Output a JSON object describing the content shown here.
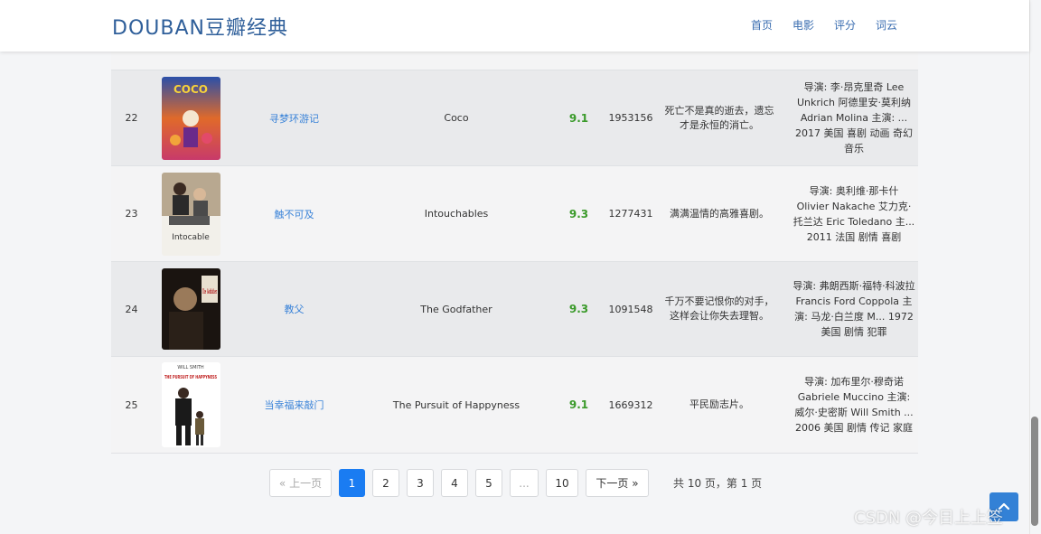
{
  "navbar": {
    "brand": "DOUBAN豆瓣经典",
    "links": [
      "首页",
      "电影",
      "评分",
      "词云"
    ]
  },
  "movies": [
    {
      "rank": "22",
      "title_cn": "寻梦环游记",
      "title_en": "Coco",
      "score": "9.1",
      "votes": "1953156",
      "quote": "死亡不是真的逝去，遗忘才是永恒的消亡。",
      "info": "导演: 李·昂克里奇 Lee Unkrich 阿德里安·莫利纳 Adrian Molina 主演: ... 2017 美国 喜剧 动画 奇幻 音乐"
    },
    {
      "rank": "23",
      "title_cn": "触不可及",
      "title_en": "Intouchables",
      "score": "9.3",
      "votes": "1277431",
      "quote": "满满温情的高雅喜剧。",
      "info": "导演: 奥利维·那卡什 Olivier Nakache 艾力克·托兰达 Eric Toledano 主... 2011 法国 剧情 喜剧"
    },
    {
      "rank": "24",
      "title_cn": "教父",
      "title_en": "The Godfather",
      "score": "9.3",
      "votes": "1091548",
      "quote": "千万不要记恨你的对手，这样会让你失去理智。",
      "info": "导演: 弗朗西斯·福特·科波拉 Francis Ford Coppola 主演: 马龙·白兰度 M... 1972 美国 剧情 犯罪"
    },
    {
      "rank": "25",
      "title_cn": "当幸福来敲门",
      "title_en": "The Pursuit of Happyness",
      "score": "9.1",
      "votes": "1669312",
      "quote": "平民励志片。",
      "info": "导演: 加布里尔·穆奇诺 Gabriele Muccino 主演: 威尔·史密斯 Will Smith ... 2006 美国 剧情 传记 家庭"
    }
  ],
  "posters": [
    {
      "text_top": "",
      "text_main": "COCO"
    },
    {
      "text_top": "",
      "text_main": "Intocable"
    },
    {
      "text_top": "",
      "text_main": "The Godfather"
    },
    {
      "text_top": "WILL SMITH",
      "text_main": "THE PURSUIT OF HAPPYNESS"
    }
  ],
  "pagination": {
    "prev": "« 上一页",
    "pages": [
      "1",
      "2",
      "3",
      "4",
      "5",
      "...",
      "10"
    ],
    "next": "下一页 »",
    "summary": "共 10 页，第 1 页",
    "current": "1"
  },
  "watermark": "CSDN @今日上上签",
  "colors": {
    "brand": "#2f5f9a",
    "link": "#3a83d8",
    "score": "#3a9a2a",
    "active_page": "#1a7cf2"
  }
}
